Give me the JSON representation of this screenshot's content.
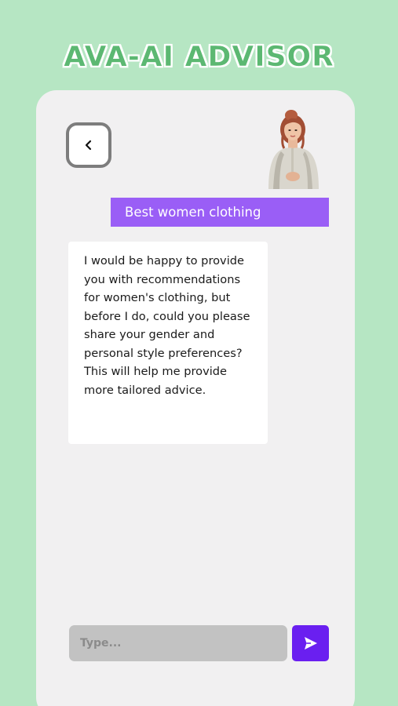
{
  "header": {
    "app_title": "AVA-AI ADVISOR"
  },
  "chat": {
    "back_icon": "chevron-left-icon",
    "avatar_icon": "advisor-avatar",
    "messages": [
      {
        "sender": "user",
        "text": "Best women clothing"
      },
      {
        "sender": "advisor",
        "text": "I would be happy to provide you with recommendations for women's clothing, but before I do, could you please share your gender and personal style preferences? This will help me provide more tailored advice."
      }
    ]
  },
  "composer": {
    "input_value": "",
    "placeholder": "Type...",
    "send_icon": "send-icon"
  },
  "colors": {
    "background": "#b6e6c3",
    "title": "#5cb872",
    "panel": "#f1f0f1",
    "user_bubble": "#9a5ef6",
    "send_button": "#6a1ff0",
    "input": "#c2c2c2"
  }
}
